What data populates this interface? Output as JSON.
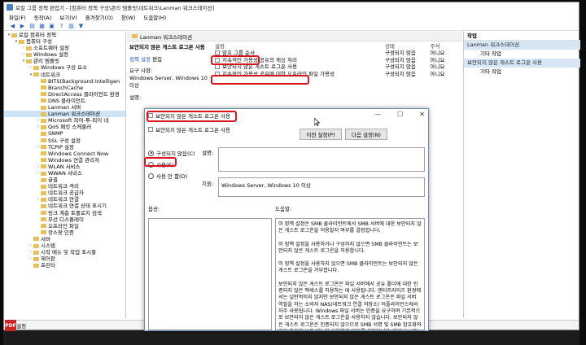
{
  "window": {
    "title": "로컬 그룹 정책 편집기 - [컴퓨터 정책 구성\\관리 템플릿\\네트워크\\Lanman 워크스테이션]",
    "menu": [
      "파일(F)",
      "동작(A)",
      "보기(V)",
      "즐겨찾기(O)",
      "창(W)",
      "도움말(H)"
    ]
  },
  "tree": {
    "items": [
      {
        "label": "로컬 컴퓨터 정책",
        "level": 0,
        "expand": "▾"
      },
      {
        "label": "컴퓨터 구성",
        "level": 1,
        "expand": "▾"
      },
      {
        "label": "소프트웨어 설정",
        "level": 2,
        "expand": "›"
      },
      {
        "label": "Windows 설정",
        "level": 2,
        "expand": "›"
      },
      {
        "label": "관리 템플릿",
        "level": 2,
        "expand": "▾"
      },
      {
        "label": "Windows 구성 요소",
        "level": 3,
        "expand": "›"
      },
      {
        "label": "네트워크",
        "level": 3,
        "expand": "▾"
      },
      {
        "label": "BITS(Background Intelligen",
        "level": 4,
        "expand": ""
      },
      {
        "label": "BranchCache",
        "level": 4,
        "expand": ""
      },
      {
        "label": "DirectAccess 클라이언트 환경",
        "level": 4,
        "expand": ""
      },
      {
        "label": "DNS 클라이언트",
        "level": 4,
        "expand": ""
      },
      {
        "label": "Lanman 서버",
        "level": 4,
        "expand": ""
      },
      {
        "label": "Lanman 워크스테이션",
        "level": 4,
        "expand": "",
        "selected": true
      },
      {
        "label": "Microsoft 피어-투-피어 네",
        "level": 4,
        "expand": "›"
      },
      {
        "label": "QoS 패킷 스케줄러",
        "level": 4,
        "expand": "›"
      },
      {
        "label": "SNMP",
        "level": 4,
        "expand": ""
      },
      {
        "label": "SSL 구성 설정",
        "level": 4,
        "expand": ""
      },
      {
        "label": "TCPIP 설정",
        "level": 4,
        "expand": "›"
      },
      {
        "label": "Windows Connect Now",
        "level": 4,
        "expand": ""
      },
      {
        "label": "Windows 연결 관리자",
        "level": 4,
        "expand": ""
      },
      {
        "label": "WLAN 서비스",
        "level": 4,
        "expand": "›"
      },
      {
        "label": "WWAN 서비스",
        "level": 4,
        "expand": "›"
      },
      {
        "label": "글꼴",
        "level": 4,
        "expand": ""
      },
      {
        "label": "네트워크 격리",
        "level": 4,
        "expand": ""
      },
      {
        "label": "네트워크 공급자",
        "level": 4,
        "expand": ""
      },
      {
        "label": "네트워크 연결",
        "level": 4,
        "expand": "›"
      },
      {
        "label": "네트워크 연결 상태 표시기",
        "level": 4,
        "expand": ""
      },
      {
        "label": "링크 계층 토폴로지 검색",
        "level": 4,
        "expand": ""
      },
      {
        "label": "무선 디스플레이",
        "level": 4,
        "expand": ""
      },
      {
        "label": "오프라인 파일",
        "level": 4,
        "expand": ""
      },
      {
        "label": "핫스팟 인증",
        "level": 4,
        "expand": ""
      },
      {
        "label": "서버",
        "level": 3,
        "expand": ""
      },
      {
        "label": "시스템",
        "level": 3,
        "expand": "›"
      },
      {
        "label": "시작 메뉴 및 작업 표시줄",
        "level": 3,
        "expand": "›"
      },
      {
        "label": "제어판",
        "level": 3,
        "expand": "›"
      },
      {
        "label": "프린터",
        "level": 3,
        "expand": ""
      }
    ]
  },
  "middle": {
    "header": "Lanman 워크스테이션",
    "desc_title": "보안되지 않은 게스트 로그온 사용",
    "desc_edit_prefix": "정책 설정",
    "desc_edit_link": "편집",
    "desc_req_label": "요구 사항:",
    "desc_req_value": "Windows Server, Windows 10 이상",
    "desc_more": "설명:",
    "columns": {
      "name": "설정",
      "state": "상태",
      "comment": "주석"
    },
    "rows": [
      {
        "name": "암호 그룹 순서",
        "state": "구성되지 않음",
        "comment": "아니요"
      },
      {
        "name": "지속적인 가용성 공유의 캐싱 처리",
        "state": "구성되지 않음",
        "comment": "아니요"
      },
      {
        "name": "보안되지 않은 게스트 로그온 사용",
        "state": "구성되지 않음",
        "comment": "아니요"
      },
      {
        "name": "지속적인 가용성 공유에 대한 오프라인 파일 가용성",
        "state": "구성되지 않음",
        "comment": "아니요"
      }
    ]
  },
  "actions": {
    "header": "작업",
    "section1": "Lanman 워크스테이션",
    "item1": "기타 작업",
    "section2": "보안되지 않은 게스트 로그온 사용",
    "item2": "기타 작업"
  },
  "statusbar": "4개 설정",
  "taskbar_app": "PDF",
  "dialog": {
    "title": "보안되지 않은 게스트 로그온 사용",
    "subtitle": "보안되지 않은 게스트 로그온 사용",
    "prev_button": "이전 설정(P)",
    "next_button": "다음 설정(N)",
    "radio_not_configured": "구성되지 않음(C)",
    "radio_enabled": "사용(E)",
    "radio_disabled": "사용 안 함(D)",
    "comment_label": "설명:",
    "supported_label": "지원:",
    "supported_value": "Windows Server, Windows 10 이상",
    "options_label": "옵션:",
    "help_label": "도움말:",
    "help_paragraphs": [
      "이 정책 설정은 SMB 클라이언트에서 SMB 서버에 대한 보안되지 않은 게스트 로그온을 허용할지 여부를 결정합니다.",
      "이 정책 설정을 사용하거나 구성하지 않으면 SMB 클라이언트는 보안되지 않은 게스트 로그온을 허용합니다.",
      "이 정책 설정을 사용하지 않으면 SMB 클라이언트는 보안되지 않은 게스트 로그온을 거부합니다.",
      "보안되지 않은 게스트 로그온은 파일 서버에서 공유 폴더에 대한 인증되지 않은 액세스를 허용하는 데 사용됩니다. 엔터프라이즈 환경에서는 일반적이지 않지만 보안되지 않은 게스트 로그온은 파일 서버 역할을 하는 소비자 NAS(네트워크 연결 저장소) 어플라이언스에서 자주 사용됩니다. Windows 파일 서버는 인증을 요구하며 기본적으로 보안되지 않은 게스트 로그온을 사용하지 않습니다. 보안되지 않은 게스트 로그온은 인증되지 않으므로 SMB 서명 및 SMB 암호화와 같은 중요한 보안 기능이 사용하지 않도록 설정됩니다. 따라서 보안되지 않은 게스트 로그온을 허용하는 클라이언트는 다양한 메시지 가로채기(man-in-the-middle) 공격에 취약하게"
    ]
  }
}
